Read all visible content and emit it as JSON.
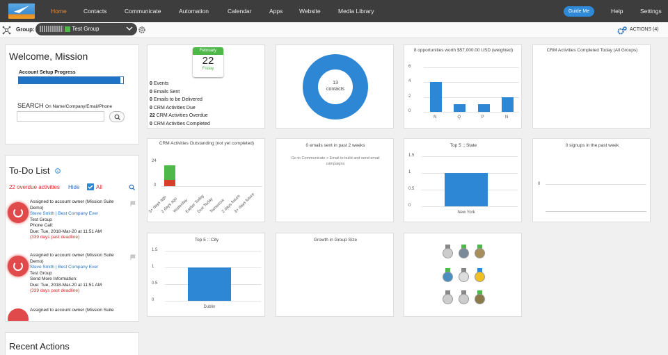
{
  "nav": {
    "items": [
      "Home",
      "Contacts",
      "Communicate",
      "Automation",
      "Calendar",
      "Apps",
      "Website",
      "Media Library"
    ],
    "guide_me": "Guide Me",
    "help": "Help",
    "settings": "Settings"
  },
  "groupbar": {
    "label": "Group:",
    "selected": "Test Group",
    "actions": "ACTIONS (4)"
  },
  "welcome": {
    "title": "Welcome, Mission",
    "progress_label": "Account Setup Progress",
    "progress": 0.97,
    "search_label": "SEARCH",
    "search_hint": "On Name/Company/Email/Phone"
  },
  "todo": {
    "title": "To-Do List",
    "overdue": "22 overdue activities",
    "hide": "Hide",
    "all": "All",
    "items": [
      {
        "title": "Assigned to account owner (Mission Suite Demo)",
        "contact": "Steve Smith",
        "company": "Best Company Ever",
        "group": "Test Group",
        "type": "Phone Call:",
        "due": "Due: Tue, 2018-Mar-20 at 11:51 AM",
        "late": "(339 days past deadline)"
      },
      {
        "title": "Assigned to account owner (Mission Suite Demo)",
        "contact": "Steve Smith",
        "company": "Best Company Ever",
        "group": "Test Group",
        "type": "Send More Information:",
        "due": "Due: Tue, 2018-Mar-20 at 11:51 AM",
        "late": "(339 days past deadline)"
      },
      {
        "title": "Assigned to account owner (Mission Suite"
      }
    ]
  },
  "recent": {
    "title": "Recent Actions"
  },
  "calendar": {
    "month": "February",
    "day": "22",
    "weekday": "Friday"
  },
  "stats": [
    {
      "n": "0",
      "label": "Events"
    },
    {
      "n": "0",
      "label": "Emails Sent"
    },
    {
      "n": "0",
      "label": "Emails to be Delivered"
    },
    {
      "n": "0",
      "label": "CRM Activities Due"
    },
    {
      "n": "22",
      "label": "CRM Activities Overdue"
    },
    {
      "n": "0",
      "label": "CRM Activities Completed"
    }
  ],
  "donut": {
    "count": "13",
    "label": "contacts"
  },
  "opps": {
    "title": "8 opportunities worth $57,000.00 USD (weighted)",
    "ticks": [
      "6",
      "4",
      "2",
      "0"
    ],
    "cats": [
      "N",
      "Q",
      "P",
      "N"
    ],
    "values": [
      4,
      1,
      1,
      2
    ],
    "max": 6
  },
  "crm_today": {
    "title": "CRM Activities Completed Today (All Groups)"
  },
  "crm_out": {
    "title": "CRM Activities Outstanding (not yet completed)",
    "ticks": [
      "24",
      "0"
    ],
    "cats": [
      "3+ days ago",
      "2 days ago",
      "Yesterday",
      "Earlier Today",
      "Due Today",
      "Tomorrow",
      "2 days future",
      "3+ days future"
    ]
  },
  "emails": {
    "title": "0 emails sent in past 2 weeks",
    "sub": "Go to Communicate > Email to build and send email campaigns"
  },
  "state": {
    "title": "Top 5 :: State",
    "ticks": [
      "1.5",
      "1",
      "0.5",
      "0"
    ],
    "cat": "New York",
    "value": 1,
    "max": 1.5
  },
  "signups": {
    "title": "0 signups in the past week",
    "tick": "0"
  },
  "city": {
    "title": "Top 5 :: City",
    "ticks": [
      "1.5",
      "1",
      "0.5",
      "0"
    ],
    "cat": "Dublin",
    "value": 1,
    "max": 1.5
  },
  "growth": {
    "title": "Growth in Group Size"
  },
  "colors": {
    "accent": "#ef8a2a",
    "blue": "#2d87d4",
    "green": "#4fb84a",
    "red": "#d62b2b",
    "nav_bg": "#3d3d3d"
  }
}
